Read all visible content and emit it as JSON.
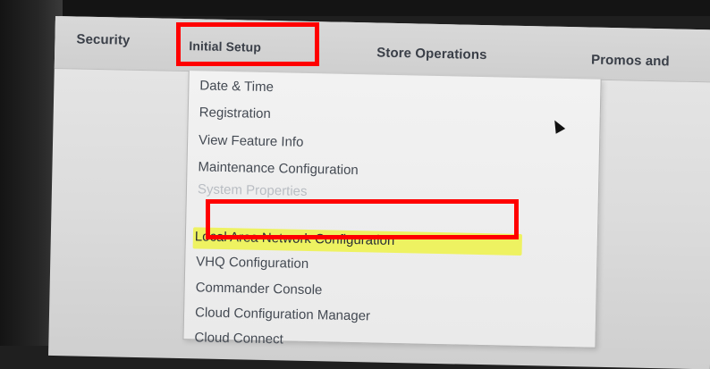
{
  "menubar": {
    "items": [
      "Security",
      "Initial Setup",
      "Store Operations",
      "Promos and"
    ]
  },
  "dropdown": {
    "items": [
      "Date & Time",
      "Registration",
      "View Feature Info",
      "Maintenance Configuration",
      "System Properties",
      "Local Area Network Configuration",
      "VHQ Configuration",
      "Commander Console",
      "Cloud Configuration Manager",
      "Cloud Connect"
    ]
  },
  "colors": {
    "annotation_red": "#ff0000",
    "highlight_yellow": "#eef25a"
  }
}
